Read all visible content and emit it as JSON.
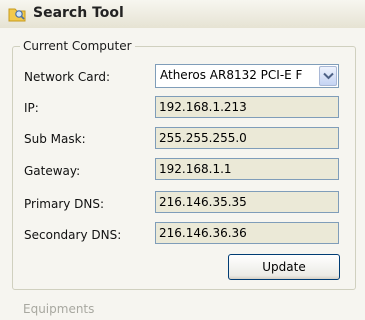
{
  "window": {
    "title": "Search Tool",
    "icon": "folder-search-icon"
  },
  "current_computer": {
    "group_label": "Current Computer",
    "network_card": {
      "label": "Network Card:",
      "value": "Atheros AR8132 PCI-E F"
    },
    "ip": {
      "label": "IP:",
      "value": "192.168.1.213"
    },
    "sub_mask": {
      "label": "Sub Mask:",
      "value": "255.255.255.0"
    },
    "gateway": {
      "label": "Gateway:",
      "value": "192.168.1.1"
    },
    "primary_dns": {
      "label": "Primary DNS:",
      "value": "216.146.35.35"
    },
    "secondary_dns": {
      "label": "Secondary DNS:",
      "value": "216.146.36.36"
    },
    "update_label": "Update"
  },
  "equipments": {
    "group_label": "Equipments"
  },
  "colors": {
    "field_bg": "#ebe9d7",
    "field_border": "#7f9db9",
    "button_border": "#003c74"
  }
}
